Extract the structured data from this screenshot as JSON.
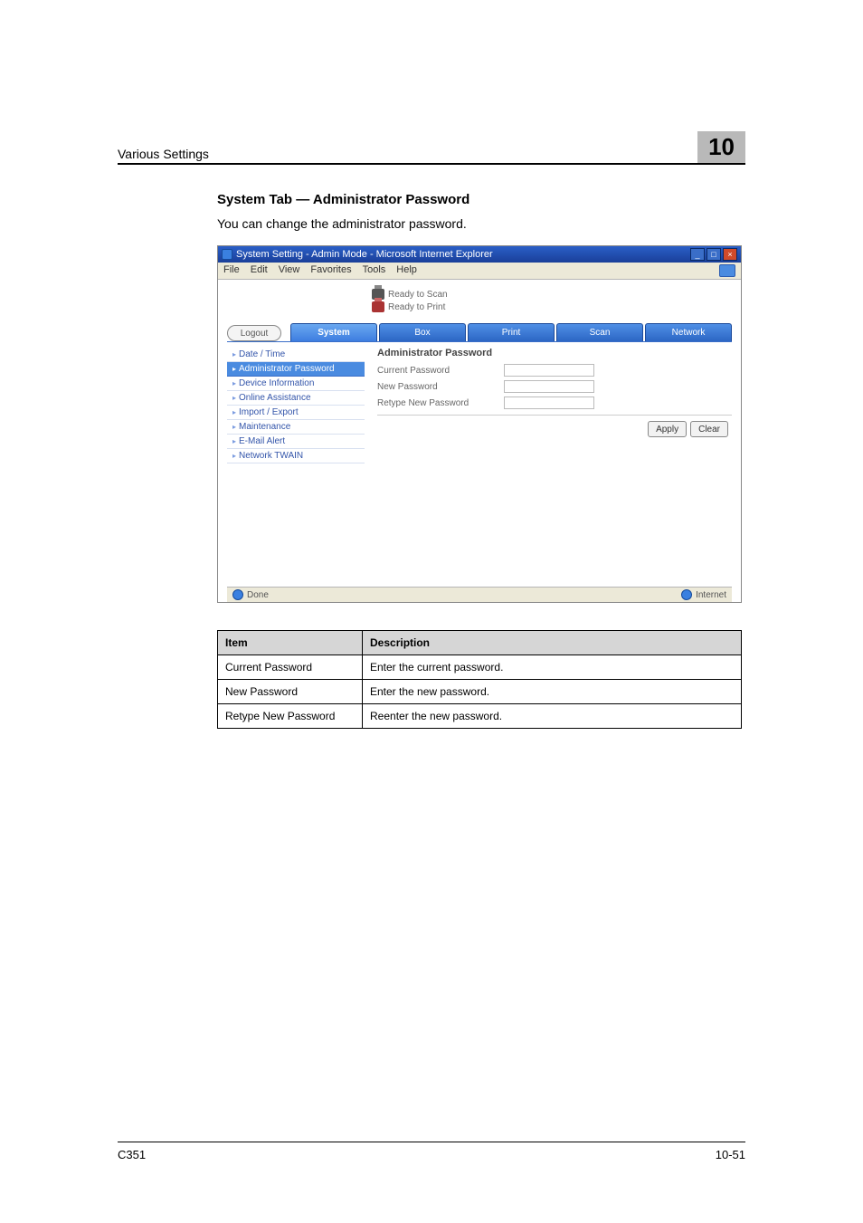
{
  "header": {
    "title": "Various Settings",
    "chapter": "10"
  },
  "section": {
    "heading": "System Tab — Administrator Password",
    "intro": "You can change the administrator password."
  },
  "screenshot": {
    "window_title": "System Setting - Admin Mode - Microsoft Internet Explorer",
    "menus": [
      "File",
      "Edit",
      "View",
      "Favorites",
      "Tools",
      "Help"
    ],
    "status_lines": [
      "Ready to Scan",
      "Ready to Print"
    ],
    "logout": "Logout",
    "tabs": [
      "System",
      "Box",
      "Print",
      "Scan",
      "Network"
    ],
    "sidebar": [
      "Date / Time",
      "Administrator Password",
      "Device Information",
      "Online Assistance",
      "Import / Export",
      "Maintenance",
      "E-Mail Alert",
      "Network TWAIN"
    ],
    "panel_title": "Administrator Password",
    "form": {
      "current_label": "Current Password",
      "new_label": "New Password",
      "retype_label": "Retype New Password"
    },
    "buttons": {
      "apply": "Apply",
      "clear": "Clear"
    },
    "statusbar": {
      "left": "Done",
      "right": "Internet"
    }
  },
  "table": {
    "headers": [
      "Item",
      "Description"
    ],
    "rows": [
      {
        "item": "Current Password",
        "desc": "Enter the current password."
      },
      {
        "item": "New Password",
        "desc": "Enter the new password."
      },
      {
        "item": "Retype New Password",
        "desc": "Reenter the new password."
      }
    ]
  },
  "footer": {
    "left": "C351",
    "right": "10-51"
  }
}
